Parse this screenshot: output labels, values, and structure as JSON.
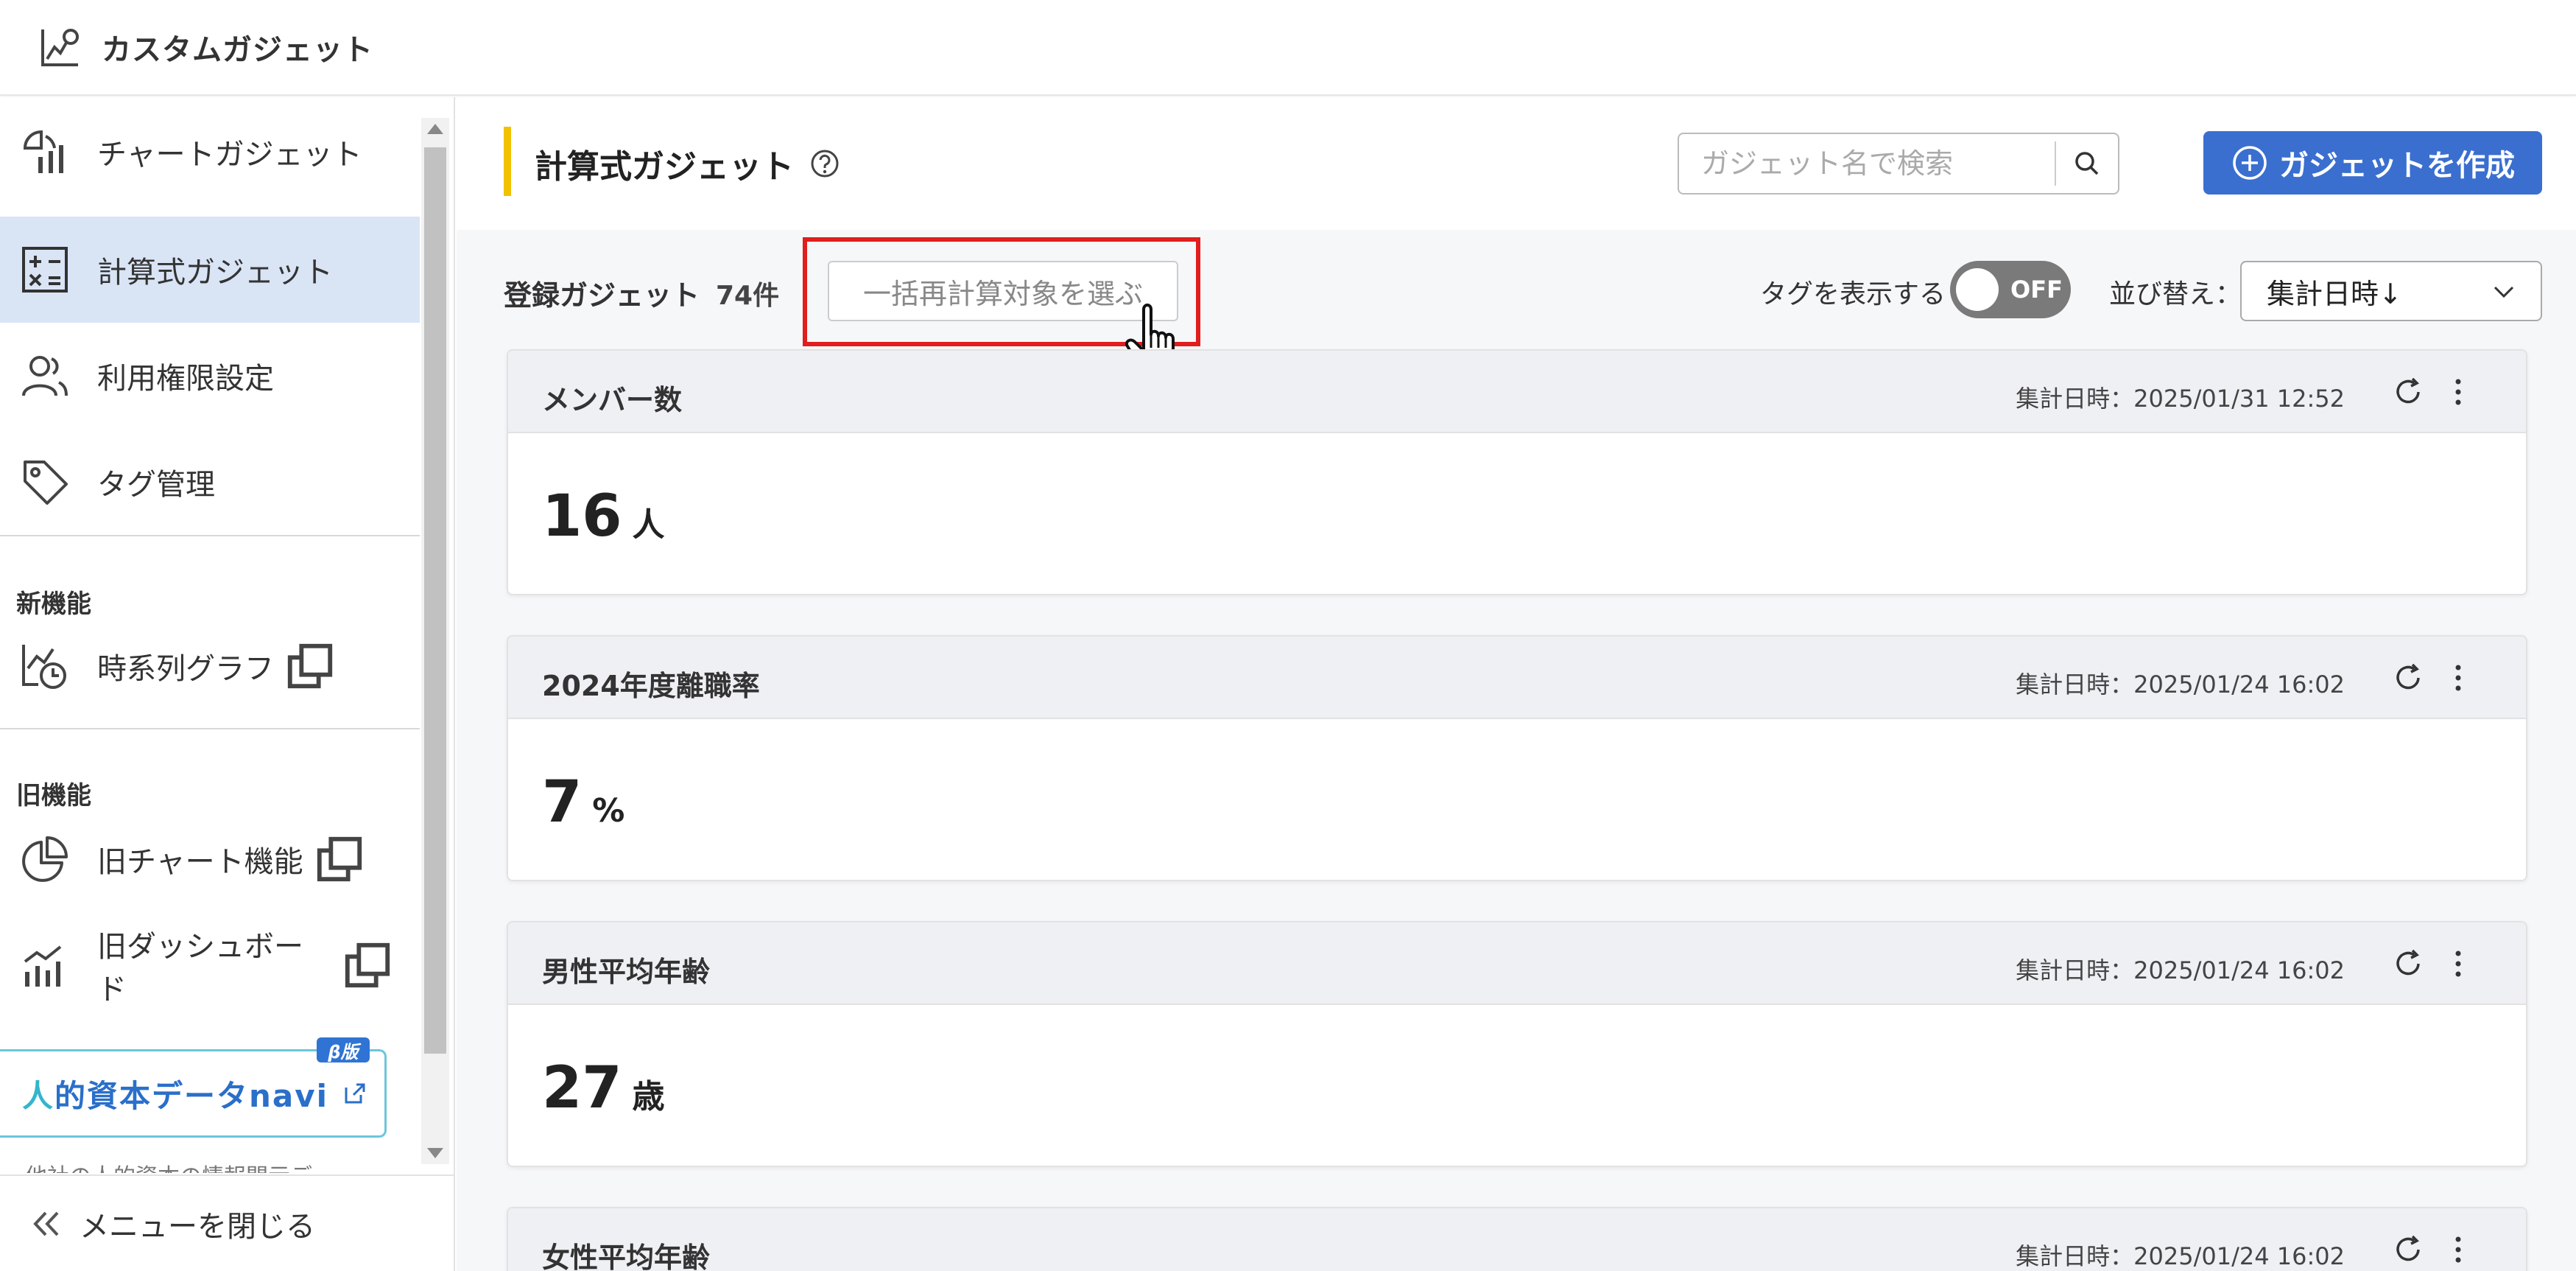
{
  "header": {
    "title": "カスタムガジェット"
  },
  "sidebar": {
    "items": [
      {
        "label": "チャートガジェット",
        "icon": "chart-gadget-icon"
      },
      {
        "label": "計算式ガジェット",
        "icon": "calculator-icon",
        "active": true
      },
      {
        "label": "利用権限設定",
        "icon": "users-icon"
      },
      {
        "label": "タグ管理",
        "icon": "tag-icon"
      }
    ],
    "new_section": "新機能",
    "new_items": [
      {
        "label": "時系列グラフ",
        "icon": "timeseries-icon"
      }
    ],
    "old_section": "旧機能",
    "old_items": [
      {
        "label": "旧チャート機能",
        "icon": "pie-chart-icon"
      },
      {
        "label": "旧ダッシュボード",
        "icon": "dashboard-icon"
      }
    ],
    "banner": {
      "text_accent": "人",
      "text_main": "的資本データnavi",
      "badge": "β版",
      "subtext": "他社の人的資本の情報開示デ"
    },
    "close_menu": "メニューを閉じる"
  },
  "main": {
    "title": "計算式ガジェット",
    "search": {
      "placeholder": "ガジェット名で検索"
    },
    "create_button": "ガジェットを作成",
    "count_label": "登録ガジェット",
    "count": "74件",
    "bulk_button": "一括再計算対象を選ぶ",
    "tag_toggle_label": "タグを表示する",
    "tag_toggle_state": "OFF",
    "sort_label": "並び替え：",
    "sort_value": "集計日時↓",
    "cards": [
      {
        "title": "メンバー数",
        "date": "集計日時：2025/01/31 12:52",
        "value": "16",
        "unit": "人"
      },
      {
        "title": "2024年度離職率",
        "date": "集計日時：2025/01/24 16:02",
        "value": "7",
        "unit": "%"
      },
      {
        "title": "男性平均年齢",
        "date": "集計日時：2025/01/24 16:02",
        "value": "27",
        "unit": "歳"
      },
      {
        "title": "女性平均年齢",
        "date": "集計日時：2025/01/24 16:02",
        "value": "",
        "unit": ""
      }
    ]
  },
  "colors": {
    "accent": "#3a6fd0",
    "active_bg": "#d9e4f5",
    "title_bar": "#f2c200",
    "highlight": "#e11d1d"
  }
}
